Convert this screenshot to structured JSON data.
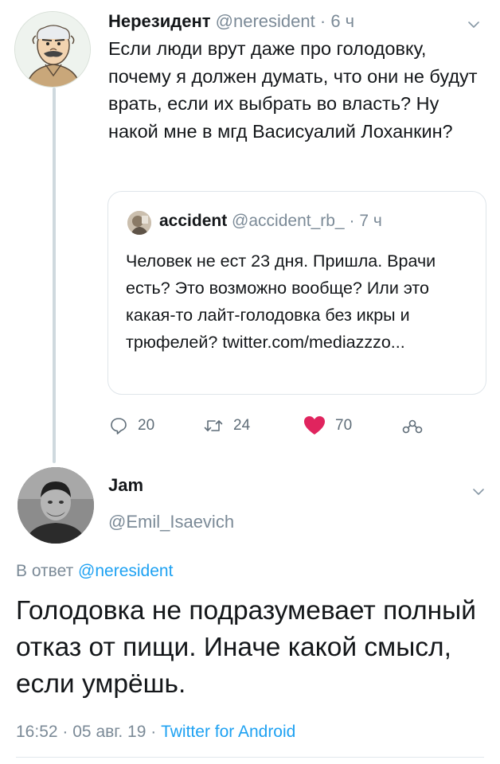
{
  "tweet1": {
    "author_name": "Нерезидент",
    "author_handle": "@neresident",
    "separator": "·",
    "time": "6 ч",
    "text": "Если люди врут даже про голодовку, почему я должен думать, что они не будут врать, если их выбрать во власть? Ну накой мне в мгд Васисуалий Лоханкин?",
    "quote": {
      "author_name": "accident",
      "author_handle": "@accident_rb_",
      "separator": "·",
      "time": "7 ч",
      "text": "Человек не ест 23 дня. Пришла. Врачи есть? Это возможно вообще? Или это какая-то лайт-голодовка без икры и трюфелей? twitter.com/mediazzzo..."
    },
    "actions": {
      "replies": "20",
      "retweets": "24",
      "likes": "70"
    },
    "icons": [
      "chevron-down-icon",
      "reply-icon",
      "retweet-icon",
      "heart-icon",
      "share-icon"
    ]
  },
  "tweet2": {
    "author_name": "Jam",
    "author_handle": "@Emil_Isaevich",
    "reply_prefix": "В ответ",
    "reply_to": "@neresident",
    "text": "Голодовка не подразумевает полный отказ от пищи. Иначе какой смысл, если умрёшь.",
    "time": "16:52",
    "date": "05 авг. 19",
    "source": "Twitter for Android",
    "separator": "·"
  },
  "colors": {
    "accent": "#1da1f2",
    "like": "#e0245e",
    "muted_text": "#7b8a97",
    "thread_line": "#cfd9de"
  }
}
